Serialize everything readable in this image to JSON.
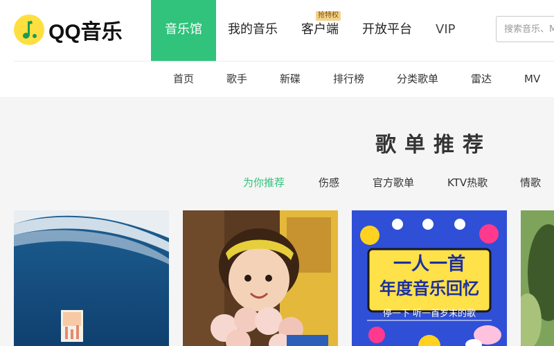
{
  "brand": {
    "logo_text": "QQ音乐",
    "accent_color": "#31c27c",
    "logo_color": "#ffdf40"
  },
  "nav": {
    "items": [
      {
        "label": "音乐馆",
        "active": true
      },
      {
        "label": "我的音乐",
        "active": false
      },
      {
        "label": "客户端",
        "active": false,
        "badge": "抢特权"
      },
      {
        "label": "开放平台",
        "active": false
      },
      {
        "label": "VIP",
        "active": false
      }
    ]
  },
  "search": {
    "placeholder": "搜索音乐、MV、歌单、用户"
  },
  "subnav": {
    "items": [
      "首页",
      "歌手",
      "新碟",
      "排行榜",
      "分类歌单",
      "雷达",
      "MV"
    ]
  },
  "section": {
    "title": "歌单推荐",
    "tags": [
      {
        "label": "为你推荐",
        "active": true
      },
      {
        "label": "伤感",
        "active": false
      },
      {
        "label": "官方歌单",
        "active": false
      },
      {
        "label": "KTV热歌",
        "active": false
      },
      {
        "label": "情歌",
        "active": false
      }
    ]
  },
  "playlists": [
    {
      "cover": "ocean-wave-art",
      "icon": "wave-cover-image"
    },
    {
      "cover": "girl-with-flowers-photo",
      "icon": "girl-cover-image"
    },
    {
      "cover": "year-end-music-memory-poster",
      "headline": "一人一首",
      "subheadline": "年度音乐回忆",
      "caption": "停一下 听一首岁末的歌"
    },
    {
      "cover": "green-photo",
      "icon": "green-cover-image"
    }
  ]
}
